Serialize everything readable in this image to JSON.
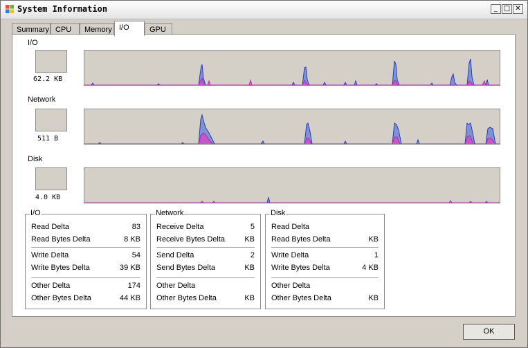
{
  "window": {
    "title": "System Information",
    "minimize_glyph": "_",
    "maximize_glyph": "□",
    "close_glyph": "✕"
  },
  "tabs": [
    {
      "label": "Summary"
    },
    {
      "label": "CPU"
    },
    {
      "label": "Memory"
    },
    {
      "label": "I/O"
    },
    {
      "label": "GPU"
    }
  ],
  "active_tab": "I/O",
  "graphs": {
    "io": {
      "label": "I/O",
      "value": "62.2 KB"
    },
    "network": {
      "label": "Network",
      "value": "511 B"
    },
    "disk": {
      "label": "Disk",
      "value": "4.0 KB"
    }
  },
  "groups": {
    "io": {
      "title": "I/O",
      "rows": [
        {
          "label": "Read Delta",
          "value": "83"
        },
        {
          "label": "Read Bytes Delta",
          "value": "8 KB"
        },
        {
          "label": "Write Delta",
          "value": "54"
        },
        {
          "label": "Write Bytes Delta",
          "value": "39 KB"
        },
        {
          "label": "Other Delta",
          "value": "174"
        },
        {
          "label": "Other Bytes Delta",
          "value": "44 KB"
        }
      ]
    },
    "network": {
      "title": "Network",
      "rows": [
        {
          "label": "Receive Delta",
          "value": "5"
        },
        {
          "label": "Receive Bytes Delta",
          "value": "KB"
        },
        {
          "label": "Send Delta",
          "value": "2"
        },
        {
          "label": "Send Bytes Delta",
          "value": "KB"
        },
        {
          "label": "Other Delta",
          "value": ""
        },
        {
          "label": "Other Bytes Delta",
          "value": "KB"
        }
      ]
    },
    "disk": {
      "title": "Disk",
      "rows": [
        {
          "label": "Read Delta",
          "value": ""
        },
        {
          "label": "Read Bytes Delta",
          "value": "KB"
        },
        {
          "label": "Write Delta",
          "value": "1"
        },
        {
          "label": "Write Bytes Delta",
          "value": "4 KB"
        },
        {
          "label": "Other Delta",
          "value": ""
        },
        {
          "label": "Other Bytes Delta",
          "value": "KB"
        }
      ]
    }
  },
  "ok_label": "OK",
  "colors": {
    "series_write": "#3a5fd9",
    "series_read": "#e040c8",
    "graph_bg": "#d4d0c8"
  }
}
